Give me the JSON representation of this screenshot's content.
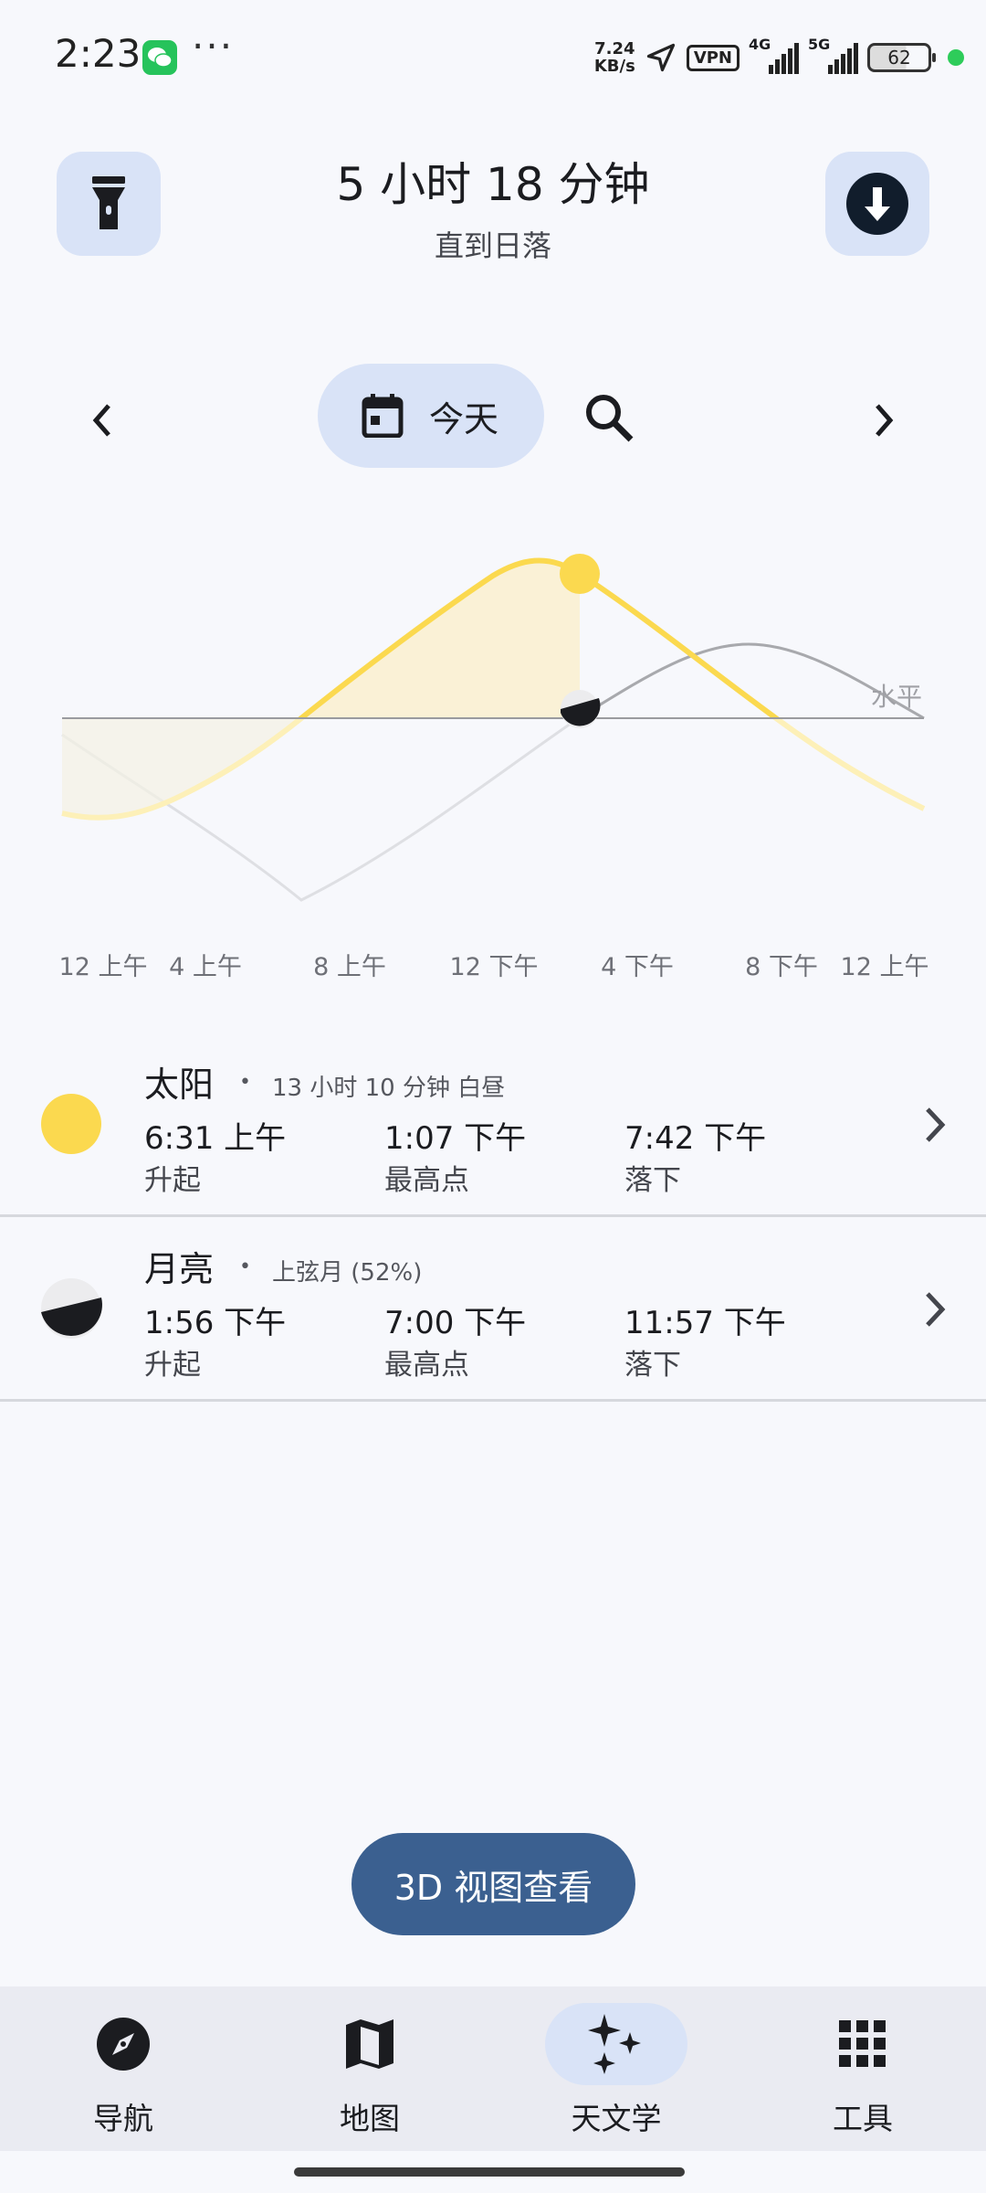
{
  "status_bar": {
    "time": "2:23",
    "more": "···",
    "speed_value": "7.24",
    "speed_unit": "KB/s",
    "vpn": "VPN",
    "net1": "4G",
    "net2": "5G",
    "battery": "62",
    "colors": {
      "wechat": "#26c35b",
      "dot": "#2ecc5a"
    }
  },
  "header": {
    "title": "5 小时 18 分钟",
    "subtitle": "直到日落",
    "left_icon": "flashlight-icon",
    "right_icon": "download-icon"
  },
  "date_nav": {
    "date_label": "今天",
    "icons": [
      "chevron-left-icon",
      "calendar-icon",
      "search-icon",
      "chevron-right-icon"
    ]
  },
  "chart_data": {
    "type": "line",
    "horizon_label": "水平",
    "x_ticks": [
      "12 上午",
      "4 上午",
      "8 上午",
      "12 下午",
      "4 下午",
      "8 下午",
      "12 上午"
    ],
    "series_colors": {
      "sun": "#fbd94f",
      "moon": "#a8a9ad",
      "horizon": "#9a9b9f"
    },
    "current_time_marker": "1:07 下午"
  },
  "celestial": [
    {
      "name": "太阳",
      "bullet": "•",
      "desc": "13 小时 10 分钟 白昼",
      "events": [
        {
          "time": "6:31 上午",
          "label": "升起"
        },
        {
          "time": "1:07 下午",
          "label": "最高点"
        },
        {
          "time": "7:42 下午",
          "label": "落下"
        }
      ]
    },
    {
      "name": "月亮",
      "bullet": "•",
      "desc": "上弦月 (52%)",
      "events": [
        {
          "time": "1:56 下午",
          "label": "升起"
        },
        {
          "time": "7:00 下午",
          "label": "最高点"
        },
        {
          "time": "11:57 下午",
          "label": "落下"
        }
      ]
    }
  ],
  "view3d_button": "3D 视图查看",
  "bottom_nav": [
    {
      "label": "导航",
      "icon": "compass-icon"
    },
    {
      "label": "地图",
      "icon": "map-icon"
    },
    {
      "label": "天文学",
      "icon": "sparkle-icon",
      "active": true
    },
    {
      "label": "工具",
      "icon": "grid-icon"
    }
  ],
  "colors": {
    "accent_container": "#d9e3f7",
    "button_3d": "#3b6090",
    "background": "#f7f8fc"
  }
}
